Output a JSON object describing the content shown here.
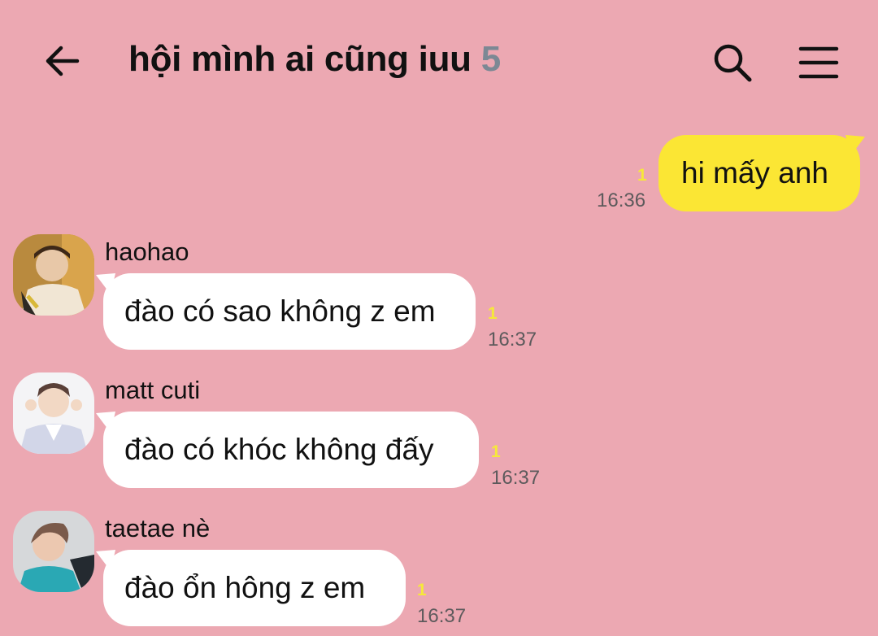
{
  "header": {
    "title": "hội mình ai cũng iuu",
    "member_count": "5"
  },
  "messages": [
    {
      "sender": "",
      "text": "hi mấy anh",
      "unread": "1",
      "time": "16:36",
      "mine": true
    },
    {
      "sender": "haohao",
      "text": "đào có sao không z em",
      "unread": "1",
      "time": "16:37",
      "mine": false
    },
    {
      "sender": "matt cuti",
      "text": "đào có khóc không đấy",
      "unread": "1",
      "time": "16:37",
      "mine": false
    },
    {
      "sender": "taetae nè",
      "text": "đào ổn hông z em",
      "unread": "1",
      "time": "16:37",
      "mine": false
    }
  ],
  "colors": {
    "background": "#eca8b2",
    "my_bubble": "#fbe634",
    "other_bubble": "#ffffff",
    "unread": "#f6e83a",
    "member_count": "#7c8894"
  }
}
